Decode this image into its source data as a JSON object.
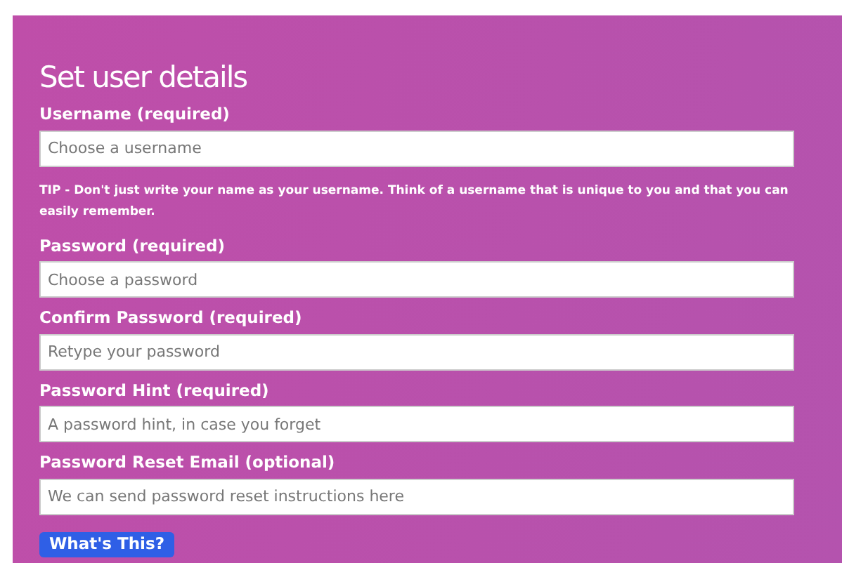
{
  "title": "Set user details",
  "fields": [
    {
      "kind": "input",
      "label": "Username (required)",
      "placeholder": "Choose a username"
    },
    {
      "kind": "tip",
      "text": "TIP - Don't just write your name as your username. Think of a username that is unique to you and that you can easily remember."
    },
    {
      "kind": "input",
      "label": "Password (required)",
      "placeholder": "Choose a password"
    },
    {
      "kind": "input",
      "label": "Confirm Password (required)",
      "placeholder": "Retype your password"
    },
    {
      "kind": "input",
      "label": "Password Hint (required)",
      "placeholder": "A password hint, in case you forget"
    },
    {
      "kind": "input",
      "label": "Password Reset Email (optional)",
      "placeholder": "We can send password reset instructions here"
    }
  ],
  "button": "What's This?"
}
